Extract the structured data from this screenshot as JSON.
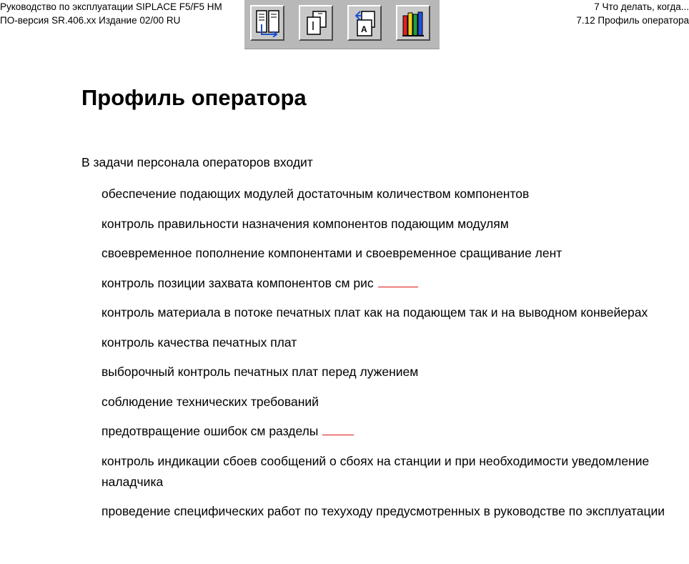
{
  "header": {
    "left_line1": "Руководство по эксплуатации SIPLACE F5/F5 HM",
    "left_line2": "ПО-версия SR.406.xx   Издание 02/00 RU",
    "right_line1": "7 Что делать, когда...",
    "right_line2": "7.12 Профиль оператора"
  },
  "toolbar": {
    "buttons": [
      {
        "icon": "contents-icon"
      },
      {
        "icon": "pages-icon"
      },
      {
        "icon": "back-icon"
      },
      {
        "icon": "library-icon"
      }
    ]
  },
  "page": {
    "title": "Профиль оператора",
    "intro": "В задачи персонала операторов входит",
    "items": [
      {
        "text": "обеспечение подающих модулей достаточным количеством компонентов"
      },
      {
        "text": "контроль правильности назначения компонентов подающим модулям"
      },
      {
        "text": "своевременное пополнение компонентами и своевременное сращивание лент"
      },
      {
        "text": "контроль позиции захвата компонентов  см  рис"
      },
      {
        "text": "контроль материала в потоке печатных плат как на подающем  так и на выводном конвейерах"
      },
      {
        "text": "контроль качества печатных плат"
      },
      {
        "text": "выборочный контроль печатных плат перед лужением"
      },
      {
        "text": "соблюдение технических требований"
      },
      {
        "text": "предотвращение ошибок  см  разделы"
      },
      {
        "text": "контроль индикации сбоев  сообщений о сбоях на станции и при необходимости уведомление наладчика"
      },
      {
        "text": "проведение специфических работ по техуходу  предусмотренных в руководстве по эксплуатации"
      }
    ]
  }
}
